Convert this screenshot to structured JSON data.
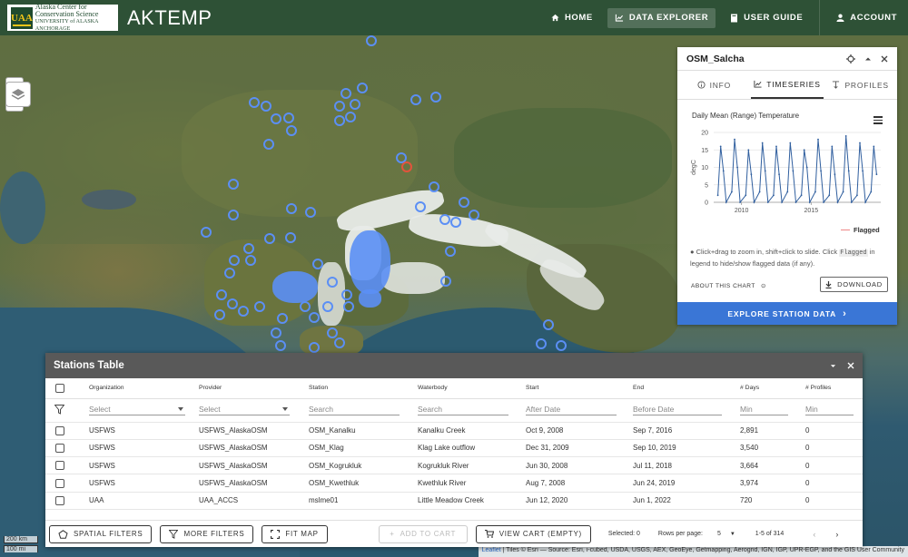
{
  "header": {
    "logo": {
      "line1": "Alaska Center for",
      "line2": "Conservation Science",
      "line3": "UNIVERSITY of ALASKA ANCHORAGE",
      "mark": "UAA"
    },
    "app_title": "AKTEMP",
    "nav": [
      {
        "label": "HOME",
        "icon": "home-icon"
      },
      {
        "label": "DATA EXPLORER",
        "icon": "chart-line-icon",
        "active": true
      },
      {
        "label": "USER GUIDE",
        "icon": "book-icon"
      },
      {
        "label": "ACCOUNT",
        "icon": "user-icon"
      }
    ]
  },
  "map": {
    "zoom_in": "+",
    "zoom_out": "−",
    "scale_km": "200 km",
    "scale_mi": "100 mi",
    "attribution_leaflet": "Leaflet",
    "attribution_rest": " | Tiles © Esri — Source: Esri, i-cubed, USDA, USGS, AEX, GeoEye, Getmapping, Aerogrid, IGN, IGP, UPR-EGP, and the GIS User Community",
    "colors": {
      "marker": "#5b8ff5",
      "selected_marker": "#e2543c"
    }
  },
  "station_panel": {
    "title": "OSM_Salcha",
    "tabs": [
      {
        "label": "INFO",
        "icon": "info-icon"
      },
      {
        "label": "TIMESERIES",
        "icon": "chart-line-icon",
        "active": true
      },
      {
        "label": "PROFILES",
        "icon": "profile-icon"
      }
    ],
    "chart_title": "Daily Mean (Range) Temperature",
    "legend_flagged": "Flagged",
    "note_before": "Click+drag to zoom in, shift+click to slide. Click ",
    "note_code": "Flagged",
    "note_after": " in legend to hide/show flagged data (if any).",
    "about_label": "ABOUT THIS CHART",
    "download_label": "DOWNLOAD",
    "explore_label": "EXPLORE STATION DATA"
  },
  "chart_data": {
    "type": "line",
    "title": "Daily Mean (Range) Temperature",
    "ylabel": "degC",
    "ylim": [
      0,
      20
    ],
    "yticks": [
      0,
      5,
      10,
      15,
      20
    ],
    "xticks": [
      "2010",
      "2015"
    ],
    "legend": [
      "Flagged"
    ],
    "series": [
      {
        "x": [
          2008.3,
          2008.5,
          2008.7,
          2008.9,
          2009.3,
          2009.5,
          2009.7,
          2009.9,
          2010.3,
          2010.5,
          2010.7,
          2010.9,
          2011.3,
          2011.5,
          2011.7,
          2011.9,
          2012.3,
          2012.5,
          2012.7,
          2012.9,
          2013.3,
          2013.5,
          2013.7,
          2013.9,
          2014.3,
          2014.5,
          2014.7,
          2014.9,
          2015.3,
          2015.5,
          2015.7,
          2015.9,
          2016.3,
          2016.5,
          2016.7,
          2016.9,
          2017.3,
          2017.5,
          2017.7,
          2017.9,
          2018.3,
          2018.5,
          2018.7,
          2018.9,
          2019.3,
          2019.5,
          2019.7
        ],
        "values": [
          2,
          16,
          9,
          0,
          3,
          18,
          10,
          0,
          2,
          15,
          8,
          0,
          3,
          17,
          9,
          0,
          2,
          16,
          8,
          0,
          3,
          17,
          9,
          0,
          2,
          15,
          10,
          0,
          3,
          18,
          9,
          0,
          2,
          16,
          8,
          0,
          3,
          19,
          9,
          0,
          2,
          17,
          9,
          0,
          3,
          16,
          8
        ]
      }
    ]
  },
  "stations_table": {
    "title": "Stations Table",
    "columns": [
      "Organization",
      "Provider",
      "Station",
      "Waterbody",
      "Start",
      "End",
      "# Days",
      "# Profiles"
    ],
    "filters": [
      "Select",
      "Select",
      "Search",
      "Search",
      "After Date",
      "Before Date",
      "Min",
      "Min"
    ],
    "rows": [
      [
        "USFWS",
        "USFWS_AlaskaOSM",
        "OSM_Kanalku",
        "Kanalku Creek",
        "Oct 9, 2008",
        "Sep 7, 2016",
        "2,891",
        "0"
      ],
      [
        "USFWS",
        "USFWS_AlaskaOSM",
        "OSM_Klag",
        "Klag Lake outflow",
        "Dec 31, 2009",
        "Sep 10, 2019",
        "3,540",
        "0"
      ],
      [
        "USFWS",
        "USFWS_AlaskaOSM",
        "OSM_Kogrukluk",
        "Kogrukluk River",
        "Jun 30, 2008",
        "Jul 11, 2018",
        "3,664",
        "0"
      ],
      [
        "USFWS",
        "USFWS_AlaskaOSM",
        "OSM_Kwethluk",
        "Kwethluk River",
        "Aug 7, 2008",
        "Jun 24, 2019",
        "3,974",
        "0"
      ],
      [
        "UAA",
        "UAA_ACCS",
        "mslme01",
        "Little Meadow Creek",
        "Jun 12, 2020",
        "Jun 1, 2022",
        "720",
        "0"
      ]
    ],
    "footer": {
      "spatial_filters": "SPATIAL FILTERS",
      "more_filters": "MORE FILTERS",
      "fit_map": "FIT MAP",
      "add_to_cart": "ADD TO CART",
      "view_cart": "VIEW CART (EMPTY)",
      "selected": "Selected: 0",
      "rows_per_page_label": "Rows per page:",
      "rows_per_page_value": "5",
      "range": "1-5 of 314",
      "prev": "‹",
      "next": "›"
    }
  }
}
